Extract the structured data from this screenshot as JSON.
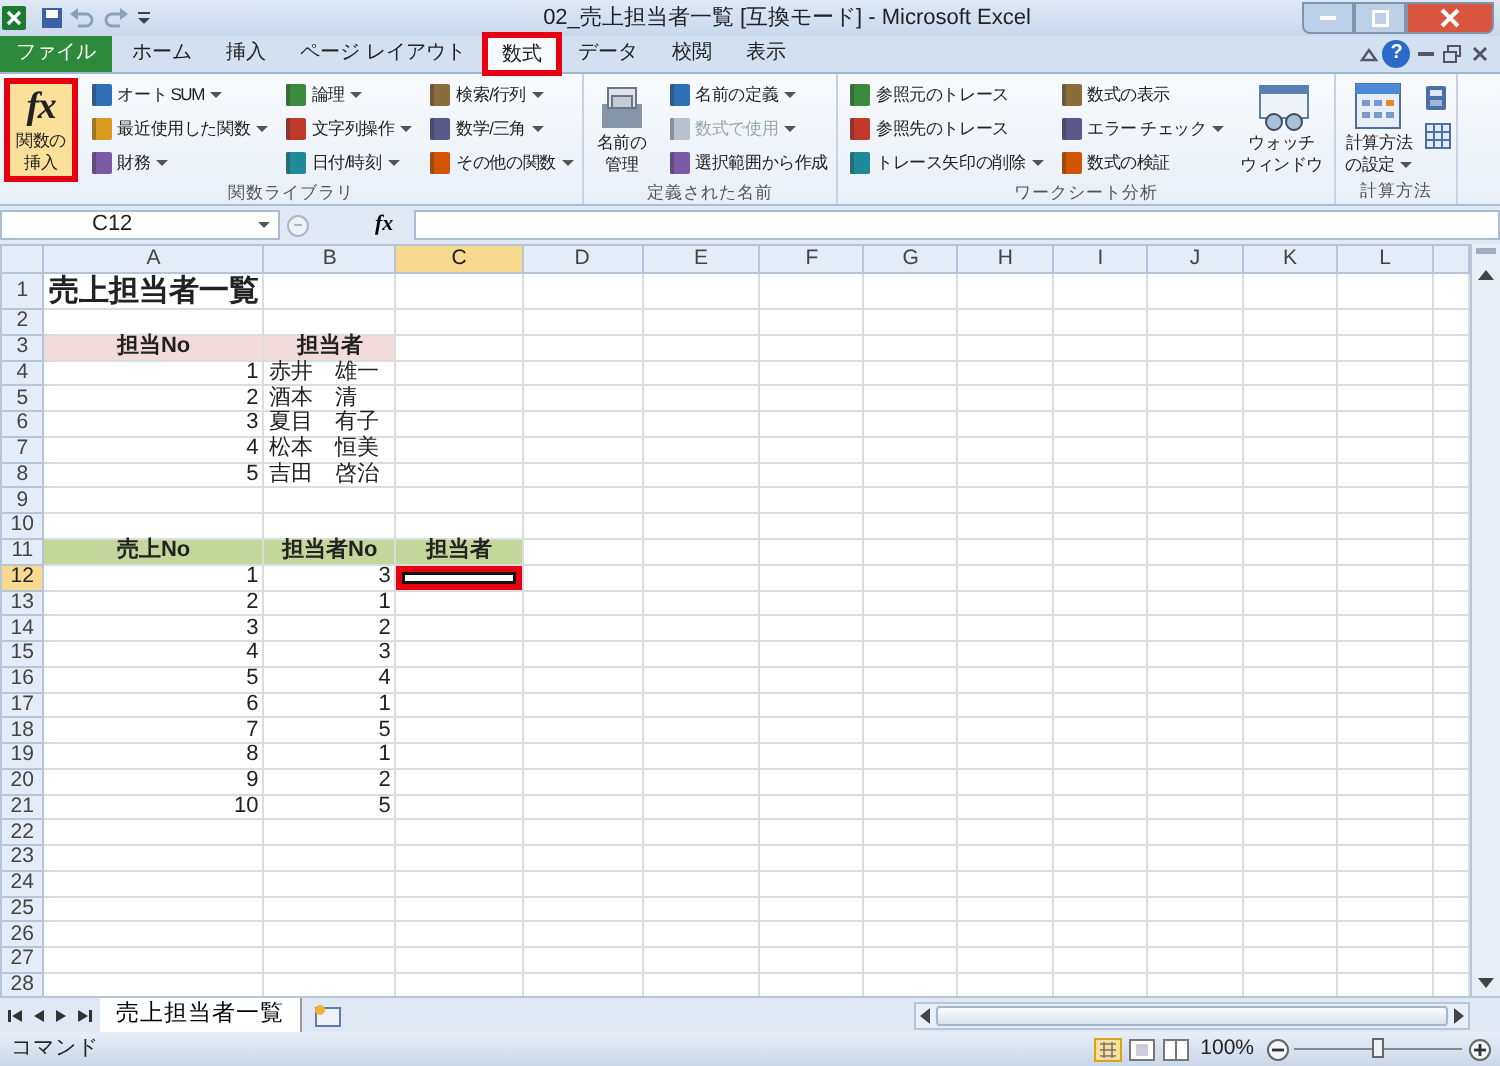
{
  "title_bar": {
    "title": "02_売上担当者一覧 [互換モード] - Microsoft Excel"
  },
  "tabs": [
    {
      "label": "ファイル",
      "kind": "file",
      "selected": false,
      "highlighted": false
    },
    {
      "label": "ホーム",
      "kind": "tab",
      "selected": false,
      "highlighted": false
    },
    {
      "label": "挿入",
      "kind": "tab",
      "selected": false,
      "highlighted": false
    },
    {
      "label": "ページ レイアウト",
      "kind": "tab",
      "selected": false,
      "highlighted": false
    },
    {
      "label": "数式",
      "kind": "tab",
      "selected": true,
      "highlighted": true
    },
    {
      "label": "データ",
      "kind": "tab",
      "selected": false,
      "highlighted": false
    },
    {
      "label": "校閲",
      "kind": "tab",
      "selected": false,
      "highlighted": false
    },
    {
      "label": "表示",
      "kind": "tab",
      "selected": false,
      "highlighted": false
    }
  ],
  "help": "?",
  "ribbon": {
    "groups": [
      {
        "label": "関数ライブラリ",
        "parts": [
          {
            "kind": "large",
            "icon_text": "fx",
            "lines": [
              "関数の",
              "挿入"
            ],
            "dropdown": false,
            "highlighted": true
          },
          {
            "kind": "column",
            "items": [
              {
                "label": "オート SUM",
                "dropdown": true,
                "disabled": false
              },
              {
                "label": "最近使用した関数",
                "dropdown": true,
                "disabled": false
              },
              {
                "label": "財務",
                "dropdown": true,
                "disabled": false
              }
            ]
          },
          {
            "kind": "column",
            "items": [
              {
                "label": "論理",
                "dropdown": true,
                "disabled": false
              },
              {
                "label": "文字列操作",
                "dropdown": true,
                "disabled": false
              },
              {
                "label": "日付/時刻",
                "dropdown": true,
                "disabled": false
              }
            ]
          },
          {
            "kind": "column",
            "items": [
              {
                "label": "検索/行列",
                "dropdown": true,
                "disabled": false
              },
              {
                "label": "数学/三角",
                "dropdown": true,
                "disabled": false
              },
              {
                "label": "その他の関数",
                "dropdown": true,
                "disabled": false
              }
            ]
          }
        ]
      },
      {
        "label": "定義された名前",
        "parts": [
          {
            "kind": "large",
            "lines": [
              "名前の",
              "管理"
            ],
            "dropdown": false,
            "highlighted": false
          },
          {
            "kind": "column",
            "items": [
              {
                "label": "名前の定義",
                "dropdown": true,
                "disabled": false
              },
              {
                "label": "数式で使用",
                "dropdown": true,
                "disabled": true
              },
              {
                "label": "選択範囲から作成",
                "dropdown": false,
                "disabled": false
              }
            ]
          }
        ]
      },
      {
        "label": "ワークシート分析",
        "parts": [
          {
            "kind": "column",
            "items": [
              {
                "label": "参照元のトレース",
                "dropdown": false,
                "disabled": false
              },
              {
                "label": "参照先のトレース",
                "dropdown": false,
                "disabled": false
              },
              {
                "label": "トレース矢印の削除",
                "dropdown": true,
                "disabled": false
              }
            ]
          },
          {
            "kind": "column",
            "items": [
              {
                "label": "数式の表示",
                "dropdown": false,
                "disabled": false
              },
              {
                "label": "エラー チェック",
                "dropdown": true,
                "disabled": false
              },
              {
                "label": "数式の検証",
                "dropdown": false,
                "disabled": false
              }
            ]
          },
          {
            "kind": "large",
            "lines": [
              "ウォッチ",
              "ウィンドウ"
            ],
            "dropdown": false,
            "highlighted": false
          }
        ]
      },
      {
        "label": "計算方法",
        "parts": [
          {
            "kind": "large",
            "lines": [
              "計算方法",
              "の設定"
            ],
            "dropdown": true,
            "highlighted": false
          },
          {
            "kind": "icons"
          }
        ]
      }
    ]
  },
  "formula_bar": {
    "name_box": "C12",
    "fx_icon": "fx"
  },
  "sheet": {
    "columns": [
      "A",
      "B",
      "C",
      "D",
      "E",
      "F",
      "G",
      "H",
      "I",
      "J",
      "K",
      "L"
    ],
    "rows": [
      {
        "number": "1",
        "cells": {
          "A": {
            "text": "売上担当者一覧",
            "kind": "title",
            "selected": false
          }
        }
      },
      {
        "number": "2"
      },
      {
        "number": "3",
        "cells": {
          "A": {
            "text": "担当No",
            "kind": "header-pink",
            "selected": false
          },
          "B": {
            "text": "担当者",
            "kind": "header-pink",
            "selected": false
          }
        }
      },
      {
        "number": "4",
        "cells": {
          "A": {
            "text": "1",
            "kind": "number",
            "selected": false
          },
          "B": {
            "text": "赤井　雄一",
            "kind": "text",
            "selected": false
          }
        }
      },
      {
        "number": "5",
        "cells": {
          "A": {
            "text": "2",
            "kind": "number",
            "selected": false
          },
          "B": {
            "text": "酒本　清",
            "kind": "text",
            "selected": false
          }
        }
      },
      {
        "number": "6",
        "cells": {
          "A": {
            "text": "3",
            "kind": "number",
            "selected": false
          },
          "B": {
            "text": "夏目　有子",
            "kind": "text",
            "selected": false
          }
        }
      },
      {
        "number": "7",
        "cells": {
          "A": {
            "text": "4",
            "kind": "number",
            "selected": false
          },
          "B": {
            "text": "松本　恒美",
            "kind": "text",
            "selected": false
          }
        }
      },
      {
        "number": "8",
        "cells": {
          "A": {
            "text": "5",
            "kind": "number",
            "selected": false
          },
          "B": {
            "text": "吉田　啓治",
            "kind": "text",
            "selected": false
          }
        }
      },
      {
        "number": "9"
      },
      {
        "number": "10"
      },
      {
        "number": "11",
        "cells": {
          "A": {
            "text": "売上No",
            "kind": "header-green",
            "selected": false
          },
          "B": {
            "text": "担当者No",
            "kind": "header-green",
            "selected": false
          },
          "C": {
            "text": "担当者",
            "kind": "header-green",
            "selected": false
          }
        }
      },
      {
        "number": "12",
        "cells": {
          "A": {
            "text": "1",
            "kind": "number",
            "selected": false
          },
          "B": {
            "text": "3",
            "kind": "number",
            "selected": false
          },
          "C": {
            "selected": true,
            "highlighted": true
          }
        }
      },
      {
        "number": "13",
        "cells": {
          "A": {
            "text": "2",
            "kind": "number",
            "selected": false
          },
          "B": {
            "text": "1",
            "kind": "number",
            "selected": false
          }
        }
      },
      {
        "number": "14",
        "cells": {
          "A": {
            "text": "3",
            "kind": "number",
            "selected": false
          },
          "B": {
            "text": "2",
            "kind": "number",
            "selected": false
          }
        }
      },
      {
        "number": "15",
        "cells": {
          "A": {
            "text": "4",
            "kind": "number",
            "selected": false
          },
          "B": {
            "text": "3",
            "kind": "number",
            "selected": false
          }
        }
      },
      {
        "number": "16",
        "cells": {
          "A": {
            "text": "5",
            "kind": "number",
            "selected": false
          },
          "B": {
            "text": "4",
            "kind": "number",
            "selected": false
          }
        }
      },
      {
        "number": "17",
        "cells": {
          "A": {
            "text": "6",
            "kind": "number",
            "selected": false
          },
          "B": {
            "text": "1",
            "kind": "number",
            "selected": false
          }
        }
      },
      {
        "number": "18",
        "cells": {
          "A": {
            "text": "7",
            "kind": "number",
            "selected": false
          },
          "B": {
            "text": "5",
            "kind": "number",
            "selected": false
          }
        }
      },
      {
        "number": "19",
        "cells": {
          "A": {
            "text": "8",
            "kind": "number",
            "selected": false
          },
          "B": {
            "text": "1",
            "kind": "number",
            "selected": false
          }
        }
      },
      {
        "number": "20",
        "cells": {
          "A": {
            "text": "9",
            "kind": "number",
            "selected": false
          },
          "B": {
            "text": "2",
            "kind": "number",
            "selected": false
          }
        }
      },
      {
        "number": "21",
        "cells": {
          "A": {
            "text": "10",
            "kind": "number",
            "selected": false
          },
          "B": {
            "text": "5",
            "kind": "number",
            "selected": false
          }
        }
      },
      {
        "number": "22"
      },
      {
        "number": "23"
      },
      {
        "number": "24"
      },
      {
        "number": "25"
      },
      {
        "number": "26"
      },
      {
        "number": "27"
      },
      {
        "number": "28"
      }
    ]
  },
  "sheet_tabs": [
    {
      "label": "売上担当者一覧",
      "selected": true
    }
  ],
  "status_bar": {
    "mode": "コマンド",
    "zoom": "100%",
    "zoom_slider": {
      "level": 0.5
    }
  }
}
